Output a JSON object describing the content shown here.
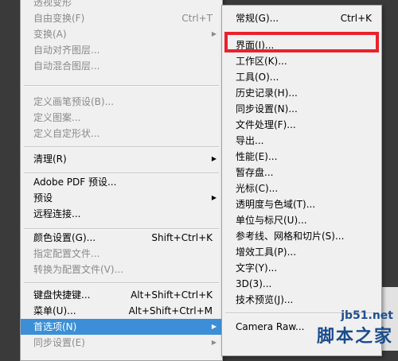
{
  "main_menu": {
    "items": [
      {
        "label": "透视变形",
        "shortcut": "",
        "disabled": true,
        "arrow": false
      },
      {
        "label": "自由变换(F)",
        "shortcut": "Ctrl+T",
        "disabled": true,
        "arrow": false
      },
      {
        "label": "变换(A)",
        "shortcut": "",
        "disabled": true,
        "arrow": true
      },
      {
        "label": "自动对齐图层...",
        "shortcut": "",
        "disabled": true,
        "arrow": false
      },
      {
        "label": "自动混合图层...",
        "shortcut": "",
        "disabled": true,
        "arrow": false
      },
      {
        "label": "定义画笔预设(B)...",
        "shortcut": "",
        "disabled": true,
        "arrow": false
      },
      {
        "label": "定义图案...",
        "shortcut": "",
        "disabled": true,
        "arrow": false
      },
      {
        "label": "定义自定形状...",
        "shortcut": "",
        "disabled": true,
        "arrow": false
      },
      {
        "label": "清理(R)",
        "shortcut": "",
        "disabled": false,
        "arrow": true
      },
      {
        "label": "Adobe PDF 预设...",
        "shortcut": "",
        "disabled": false,
        "arrow": false
      },
      {
        "label": "预设",
        "shortcut": "",
        "disabled": false,
        "arrow": true
      },
      {
        "label": "远程连接...",
        "shortcut": "",
        "disabled": false,
        "arrow": false
      },
      {
        "label": "颜色设置(G)...",
        "shortcut": "Shift+Ctrl+K",
        "disabled": false,
        "arrow": false
      },
      {
        "label": "指定配置文件...",
        "shortcut": "",
        "disabled": true,
        "arrow": false
      },
      {
        "label": "转换为配置文件(V)...",
        "shortcut": "",
        "disabled": true,
        "arrow": false
      },
      {
        "label": "键盘快捷键...",
        "shortcut": "Alt+Shift+Ctrl+K",
        "disabled": false,
        "arrow": false
      },
      {
        "label": "菜单(U)...",
        "shortcut": "Alt+Shift+Ctrl+M",
        "disabled": false,
        "arrow": false
      },
      {
        "label": "首选项(N)",
        "shortcut": "",
        "disabled": false,
        "arrow": true,
        "highlight": true
      },
      {
        "label": "同步设置(E)",
        "shortcut": "",
        "disabled": true,
        "arrow": true
      }
    ]
  },
  "sub_menu": {
    "items": [
      {
        "label": "常规(G)...",
        "shortcut": "Ctrl+K"
      },
      {
        "label": "界面(I)...",
        "shortcut": ""
      },
      {
        "label": "工作区(K)...",
        "shortcut": ""
      },
      {
        "label": "工具(O)...",
        "shortcut": ""
      },
      {
        "label": "历史记录(H)...",
        "shortcut": ""
      },
      {
        "label": "同步设置(N)...",
        "shortcut": ""
      },
      {
        "label": "文件处理(F)...",
        "shortcut": ""
      },
      {
        "label": "导出...",
        "shortcut": ""
      },
      {
        "label": "性能(E)...",
        "shortcut": ""
      },
      {
        "label": "暂存盘...",
        "shortcut": ""
      },
      {
        "label": "光标(C)...",
        "shortcut": ""
      },
      {
        "label": "透明度与色域(T)...",
        "shortcut": ""
      },
      {
        "label": "单位与标尺(U)...",
        "shortcut": ""
      },
      {
        "label": "参考线、网格和切片(S)...",
        "shortcut": ""
      },
      {
        "label": "增效工具(P)...",
        "shortcut": ""
      },
      {
        "label": "文字(Y)...",
        "shortcut": ""
      },
      {
        "label": "3D(3)...",
        "shortcut": ""
      },
      {
        "label": "技术预览(J)...",
        "shortcut": ""
      },
      {
        "label": "Camera Raw...",
        "shortcut": ""
      }
    ]
  },
  "watermark": {
    "url": "jb51.net",
    "text": "脚本之家"
  },
  "colors": {
    "highlight": "#3c8fd6",
    "annotation": "#e8222c",
    "disabled_text": "#8a8a8a",
    "menu_bg": "#f0f0f0"
  }
}
